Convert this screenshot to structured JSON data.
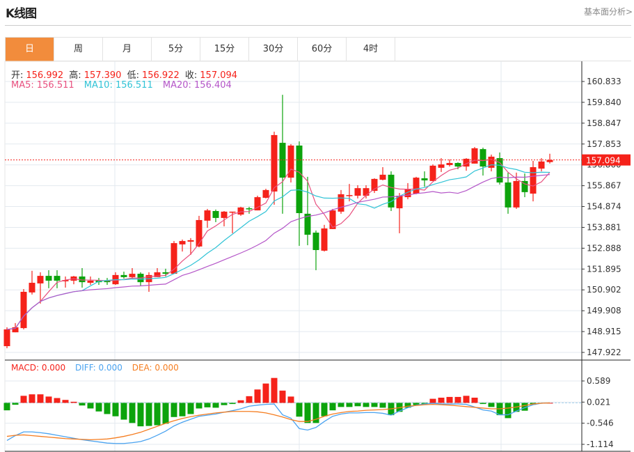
{
  "header": {
    "title": "K线图",
    "link": "基本面分析>"
  },
  "tabs": [
    {
      "label": "日",
      "active": true
    },
    {
      "label": "周"
    },
    {
      "label": "月"
    },
    {
      "label": "5分"
    },
    {
      "label": "15分"
    },
    {
      "label": "30分"
    },
    {
      "label": "60分"
    },
    {
      "label": "4时"
    }
  ],
  "ohlc_legend": {
    "open_label": "开:",
    "open": "156.992",
    "high_label": "高:",
    "high": "157.390",
    "low_label": "低:",
    "low": "156.922",
    "close_label": "收:",
    "close": "157.094"
  },
  "ma_legend": {
    "ma5": "MA5: 156.511",
    "ma10": "MA10: 156.511",
    "ma20": "MA20: 156.404"
  },
  "macd_legend": {
    "macd": "MACD: 0.000",
    "diff": "DIFF: 0.000",
    "dea": "DEA: 0.000"
  },
  "colors": {
    "up": "#f5221a",
    "down": "#0ca30c",
    "ma5": "#e8507f",
    "ma10": "#30c3d6",
    "ma20": "#b455c8",
    "diff": "#4aa3f0",
    "dea": "#f57d20",
    "active_tab": "#f28c3c"
  },
  "chart_data": [
    {
      "type": "candlestick",
      "current_price": "157.094",
      "y_ticks": [
        "160.833",
        "159.840",
        "158.847",
        "157.853",
        "156.860",
        "155.867",
        "154.874",
        "153.881",
        "152.888",
        "151.895",
        "150.902",
        "149.908",
        "148.915",
        "147.922"
      ],
      "ylim": [
        147.922,
        160.833
      ],
      "grid": true,
      "candles_ohlc": [
        [
          148.22,
          149.12,
          148.12,
          149.02
        ],
        [
          148.88,
          149.32,
          148.88,
          149.12
        ],
        [
          149.08,
          150.94,
          149.02,
          150.81
        ],
        [
          150.78,
          151.81,
          150.68,
          151.24
        ],
        [
          151.21,
          151.74,
          150.25,
          151.57
        ],
        [
          151.57,
          151.84,
          150.98,
          151.34
        ],
        [
          151.57,
          151.84,
          150.98,
          151.34
        ],
        [
          151.31,
          151.54,
          151.01,
          151.37
        ],
        [
          151.34,
          151.57,
          151.17,
          151.54
        ],
        [
          151.54,
          151.94,
          151.01,
          151.27
        ],
        [
          151.24,
          151.54,
          151.14,
          151.34
        ],
        [
          151.34,
          151.47,
          151.14,
          151.27
        ],
        [
          151.34,
          151.47,
          151.14,
          151.27
        ],
        [
          151.17,
          151.74,
          151.14,
          151.61
        ],
        [
          151.61,
          151.77,
          151.44,
          151.51
        ],
        [
          151.51,
          151.94,
          151.44,
          151.67
        ],
        [
          151.67,
          151.74,
          151.08,
          151.27
        ],
        [
          151.27,
          151.74,
          150.81,
          151.61
        ],
        [
          151.51,
          151.94,
          151.51,
          151.74
        ],
        [
          151.74,
          151.91,
          151.54,
          151.67
        ],
        [
          151.67,
          153.23,
          151.67,
          153.13
        ],
        [
          153.07,
          153.3,
          152.73,
          153.23
        ],
        [
          153.2,
          153.37,
          152.57,
          153.27
        ],
        [
          152.97,
          154.43,
          152.93,
          154.23
        ],
        [
          154.2,
          154.76,
          153.86,
          154.69
        ],
        [
          154.66,
          154.73,
          154.13,
          154.33
        ],
        [
          154.33,
          154.66,
          153.93,
          154.63
        ],
        [
          154.59,
          154.63,
          153.6,
          154.63
        ],
        [
          154.49,
          154.86,
          154.43,
          154.83
        ],
        [
          154.79,
          154.86,
          154.53,
          154.76
        ],
        [
          154.69,
          155.39,
          154.69,
          155.32
        ],
        [
          155.29,
          155.72,
          155.26,
          155.66
        ],
        [
          155.59,
          158.44,
          154.96,
          158.28
        ],
        [
          157.91,
          160.2,
          154.53,
          156.25
        ],
        [
          156.25,
          157.85,
          156.02,
          157.78
        ],
        [
          157.78,
          157.98,
          153.0,
          154.56
        ],
        [
          154.53,
          156.29,
          153.03,
          153.53
        ],
        [
          153.63,
          153.73,
          151.84,
          152.8
        ],
        [
          152.77,
          154.0,
          152.73,
          153.83
        ],
        [
          153.8,
          154.76,
          153.8,
          154.69
        ],
        [
          154.63,
          155.66,
          154.53,
          155.46
        ],
        [
          155.39,
          155.95,
          155.12,
          155.42
        ],
        [
          155.39,
          155.89,
          155.26,
          155.75
        ],
        [
          155.39,
          155.89,
          155.26,
          155.75
        ],
        [
          155.62,
          156.22,
          155.52,
          156.19
        ],
        [
          156.15,
          156.75,
          156.12,
          156.39
        ],
        [
          156.39,
          156.55,
          154.66,
          154.83
        ],
        [
          154.79,
          155.52,
          153.6,
          155.39
        ],
        [
          155.32,
          155.99,
          155.22,
          155.69
        ],
        [
          155.49,
          156.29,
          155.46,
          156.25
        ],
        [
          156.22,
          156.55,
          155.82,
          156.12
        ],
        [
          156.09,
          156.88,
          156.09,
          156.82
        ],
        [
          156.72,
          157.18,
          156.52,
          156.88
        ],
        [
          156.85,
          157.12,
          156.78,
          156.95
        ],
        [
          156.95,
          156.98,
          156.65,
          156.78
        ],
        [
          156.78,
          157.18,
          156.58,
          157.15
        ],
        [
          156.92,
          157.71,
          156.92,
          157.65
        ],
        [
          157.61,
          157.68,
          156.35,
          156.78
        ],
        [
          156.72,
          157.35,
          156.55,
          157.25
        ],
        [
          157.18,
          157.45,
          155.92,
          156.02
        ],
        [
          156.02,
          156.49,
          154.53,
          154.83
        ],
        [
          154.83,
          156.49,
          154.76,
          156.09
        ],
        [
          156.09,
          156.45,
          155.32,
          155.56
        ],
        [
          155.49,
          157.05,
          155.12,
          156.75
        ],
        [
          156.68,
          157.18,
          156.55,
          157.02
        ],
        [
          156.992,
          157.39,
          156.922,
          157.094
        ]
      ],
      "ma_periods": [
        5,
        10,
        20
      ]
    },
    {
      "type": "macd",
      "y_ticks": [
        "0.589",
        "0.021",
        "-0.546",
        "-1.114"
      ],
      "ylim": [
        -1.114,
        0.589
      ],
      "histogram": [
        -0.2,
        -0.05,
        0.19,
        0.23,
        0.23,
        0.17,
        0.13,
        0.08,
        0.03,
        -0.07,
        -0.15,
        -0.23,
        -0.3,
        -0.36,
        -0.45,
        -0.54,
        -0.63,
        -0.62,
        -0.6,
        -0.56,
        -0.38,
        -0.36,
        -0.3,
        -0.15,
        -0.12,
        -0.13,
        -0.06,
        -0.03,
        0.07,
        0.18,
        0.36,
        0.52,
        0.67,
        0.33,
        0.17,
        -0.37,
        -0.54,
        -0.54,
        -0.36,
        -0.2,
        -0.11,
        -0.11,
        -0.09,
        -0.11,
        -0.11,
        -0.13,
        -0.33,
        -0.24,
        -0.13,
        -0.06,
        -0.03,
        0.11,
        0.14,
        0.16,
        0.16,
        0.19,
        0.14,
        -0.03,
        -0.11,
        -0.33,
        -0.41,
        -0.24,
        -0.21,
        -0.05,
        -0.01,
        0.0
      ],
      "diff": [
        -1.01,
        -0.88,
        -0.78,
        -0.78,
        -0.8,
        -0.83,
        -0.87,
        -0.91,
        -0.95,
        -0.99,
        -1.02,
        -1.05,
        -1.08,
        -1.09,
        -1.09,
        -1.07,
        -1.04,
        -0.97,
        -0.87,
        -0.76,
        -0.62,
        -0.52,
        -0.44,
        -0.36,
        -0.33,
        -0.3,
        -0.25,
        -0.21,
        -0.16,
        -0.09,
        -0.06,
        -0.04,
        -0.03,
        -0.32,
        -0.41,
        -0.69,
        -0.73,
        -0.66,
        -0.5,
        -0.36,
        -0.3,
        -0.27,
        -0.27,
        -0.26,
        -0.26,
        -0.28,
        -0.33,
        -0.22,
        -0.13,
        -0.06,
        -0.03,
        -0.01,
        -0.03,
        -0.03,
        -0.03,
        -0.04,
        -0.11,
        -0.19,
        -0.22,
        -0.32,
        -0.32,
        -0.22,
        -0.13,
        -0.05,
        -0.01,
        0.0
      ],
      "dea": [
        -0.9,
        -0.87,
        -0.86,
        -0.88,
        -0.9,
        -0.92,
        -0.94,
        -0.96,
        -0.97,
        -0.98,
        -0.99,
        -0.98,
        -0.97,
        -0.94,
        -0.9,
        -0.85,
        -0.79,
        -0.71,
        -0.63,
        -0.55,
        -0.48,
        -0.42,
        -0.37,
        -0.33,
        -0.3,
        -0.27,
        -0.25,
        -0.23,
        -0.23,
        -0.23,
        -0.24,
        -0.27,
        -0.32,
        -0.38,
        -0.45,
        -0.5,
        -0.5,
        -0.44,
        -0.36,
        -0.3,
        -0.26,
        -0.23,
        -0.22,
        -0.2,
        -0.19,
        -0.18,
        -0.16,
        -0.13,
        -0.09,
        -0.07,
        -0.05,
        -0.04,
        -0.05,
        -0.06,
        -0.08,
        -0.1,
        -0.12,
        -0.14,
        -0.16,
        -0.16,
        -0.14,
        -0.11,
        -0.07,
        -0.03,
        -0.01,
        0.0
      ]
    }
  ]
}
